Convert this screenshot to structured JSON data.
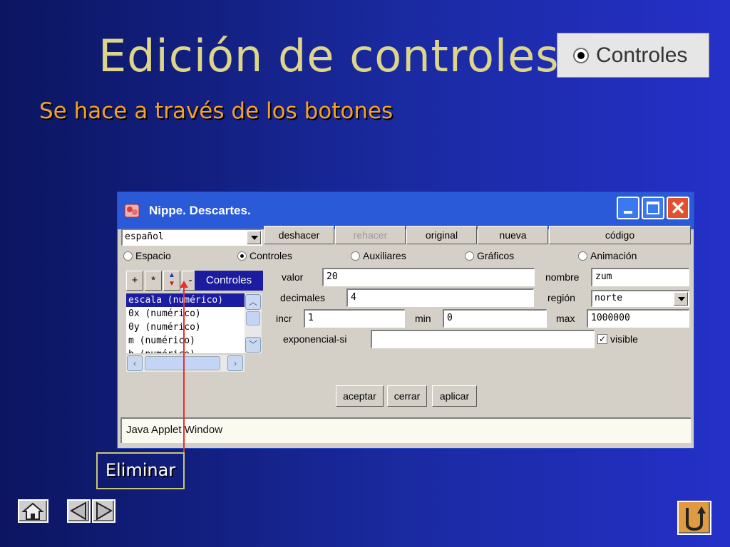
{
  "slide": {
    "title": "Edición de controles",
    "subtitle": "Se hace a través de los botones",
    "badge_label": "Controles",
    "callout": "Eliminar"
  },
  "window": {
    "title": "Nippe. Descartes.",
    "language": "español",
    "toolbar": [
      "deshacer",
      "rehacer",
      "original",
      "nueva",
      "código"
    ],
    "tabs": [
      {
        "label": "Espacio",
        "selected": false
      },
      {
        "label": "Controles",
        "selected": true
      },
      {
        "label": "Auxiliares",
        "selected": false
      },
      {
        "label": "Gráficos",
        "selected": false
      },
      {
        "label": "Animación",
        "selected": false
      }
    ],
    "list_buttons": [
      "+",
      "*",
      "-"
    ],
    "panel_label": "Controles",
    "list_items": [
      "escala (numérico)",
      "0x (numérico)",
      "0y (numérico)",
      "m (numérico)",
      "b (numérico)"
    ],
    "fields": {
      "valor_label": "valor",
      "valor": "20",
      "nombre_label": "nombre",
      "nombre": "zum",
      "decimales_label": "decimales",
      "decimales": "4",
      "region_label": "región",
      "region": "norte",
      "incr_label": "incr",
      "incr": "1",
      "min_label": "min",
      "min": "0",
      "max_label": "max",
      "max": "1000000",
      "exponencial_label": "exponencial-si",
      "exponencial": "",
      "visible_label": "visible",
      "visible": true
    },
    "actions": [
      "aceptar",
      "cerrar",
      "aplicar"
    ],
    "status": "Java Applet Window"
  },
  "colors": {
    "title": "#dcd58a",
    "subtitle": "#f2a030",
    "titlebar": "#2a5ad8",
    "pointer": "#e83030"
  },
  "icons": [
    "radio-selected-icon",
    "app-icon",
    "minimize-icon",
    "maximize-icon",
    "close-icon",
    "home-icon",
    "prev-icon",
    "next-icon",
    "return-icon"
  ]
}
